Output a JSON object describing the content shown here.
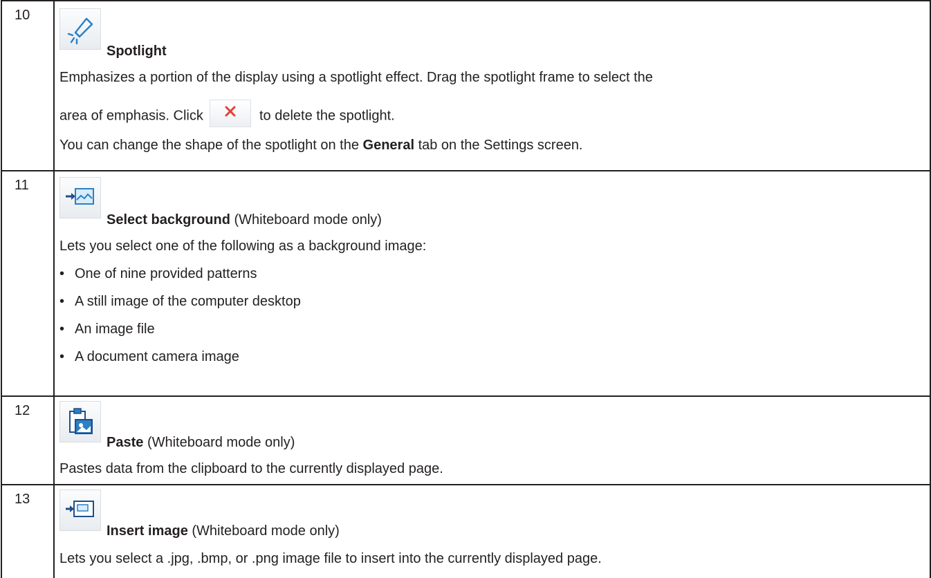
{
  "rows": [
    {
      "number": "10",
      "icon": "spotlight-icon",
      "title": "Spotlight",
      "title_suffix": "",
      "desc_line1": "Emphasizes a portion of the display using a spotlight effect. Drag the spotlight frame to select the",
      "desc_line2_before": "area of emphasis. Click",
      "desc_line2_icon": "close-icon",
      "desc_line2_after": "to delete the spotlight.",
      "desc_line3_before": "You can change the shape of the spotlight on the",
      "desc_line3_bold": "General",
      "desc_line3_after": "tab on the Settings screen."
    },
    {
      "number": "11",
      "icon": "select-background-icon",
      "title": "Select background",
      "title_suffix": "(Whiteboard mode only)",
      "desc": "Lets you select one of the following as a background image:",
      "bullet_char": "•",
      "bullets": [
        "One of nine provided patterns",
        "A still image of the computer desktop",
        "An image file",
        "A document camera image"
      ]
    },
    {
      "number": "12",
      "icon": "paste-icon",
      "title": "Paste",
      "title_suffix": "(Whiteboard mode only)",
      "desc": "Pastes data from the clipboard to the currently displayed page."
    },
    {
      "number": "13",
      "icon": "insert-image-icon",
      "title": "Insert image",
      "title_suffix": "(Whiteboard mode only)",
      "desc": "Lets you select a .jpg, .bmp, or .png image file to insert into the currently displayed page."
    }
  ],
  "colors": {
    "text": "#231f20",
    "rule": "#231f20",
    "icon_blue": "#2b7fc4",
    "close_red": "#e0403a"
  }
}
